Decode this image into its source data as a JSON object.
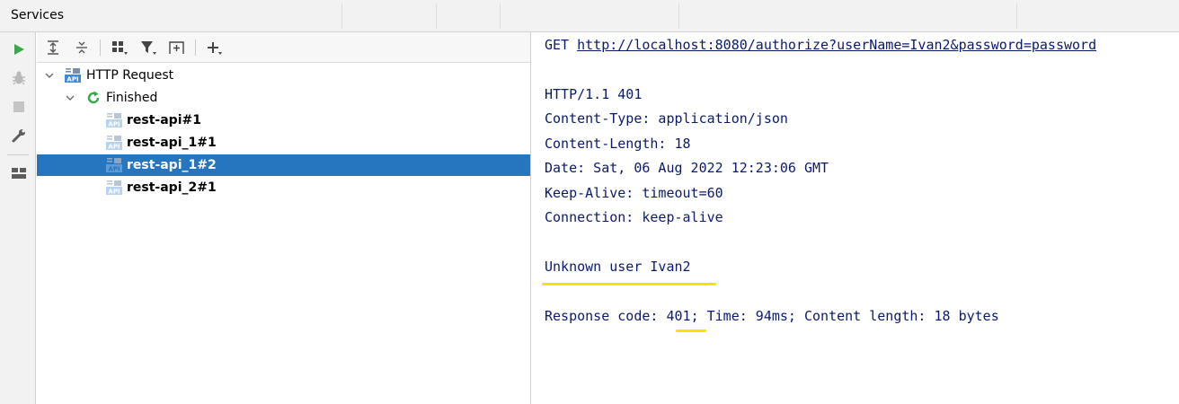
{
  "window": {
    "title": "Services"
  },
  "tree": {
    "root": {
      "label": "HTTP Request"
    },
    "group": {
      "label": "Finished"
    },
    "items": [
      {
        "label": "rest-api#1"
      },
      {
        "label": "rest-api_1#1"
      },
      {
        "label": "rest-api_1#2",
        "selected": true
      },
      {
        "label": "rest-api_2#1"
      }
    ]
  },
  "response": {
    "request_method": "GET",
    "request_url": "http://localhost:8080/authorize?userName=Ivan2&password=password",
    "status_line": "HTTP/1.1 401",
    "headers": [
      "Content-Type: application/json",
      "Content-Length: 18",
      "Date: Sat, 06 Aug 2022 12:23:06 GMT",
      "Keep-Alive: timeout=60",
      "Connection: keep-alive"
    ],
    "body": "Unknown user Ivan2",
    "summary_prefix": "Response code: ",
    "summary_code": "401",
    "summary_suffix": "; Time: 94ms; Content length: 18 bytes"
  },
  "icons": {
    "run": "run-icon",
    "debug": "debug-icon",
    "stop": "stop-icon",
    "settings": "wrench-icon",
    "layout": "layout-icon",
    "expand_all": "expand-all-icon",
    "collapse_all": "collapse-all-icon",
    "group_by": "group-by-icon",
    "filter": "filter-icon",
    "new_tab": "new-tab-icon",
    "add": "add-icon",
    "api": "api-icon",
    "refresh": "finished-icon"
  },
  "colors": {
    "selection": "#2675bf",
    "highlight": "#ffe100",
    "run_green": "#3aa54a",
    "text_blue": "#0a1a6b"
  }
}
